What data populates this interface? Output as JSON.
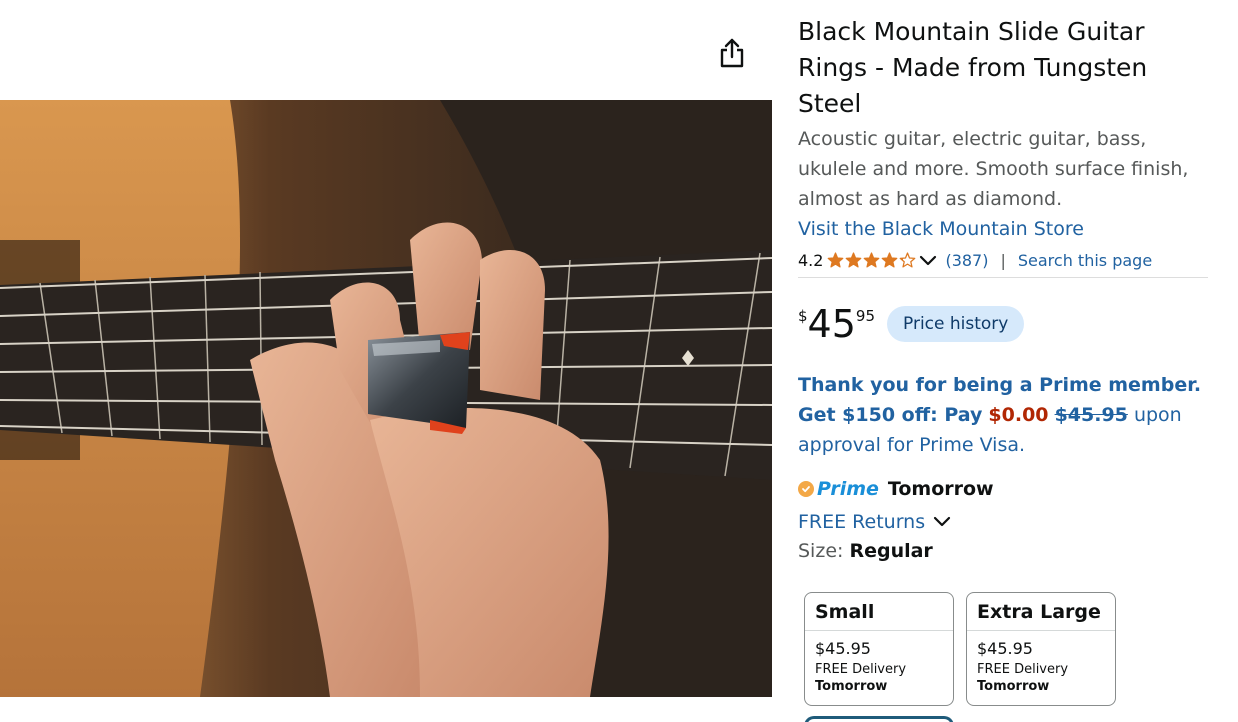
{
  "product": {
    "title": "Black Mountain Slide Guitar Rings - Made from Tungsten Steel",
    "subtitle": "Acoustic guitar, electric guitar, bass, ukulele and more. Smooth surface finish, almost as hard as diamond.",
    "store_link": "Visit the Black Mountain Store"
  },
  "rating": {
    "value": "4.2",
    "stars": 4.2,
    "review_count": "(387)",
    "separator": "|",
    "search_link": "Search this page"
  },
  "price": {
    "symbol": "$",
    "whole": "45",
    "fraction": "95",
    "history_button": "Price history"
  },
  "prime_offer": {
    "line1": "Thank you for being a Prime member.",
    "get_off": "Get $150 off: Pay",
    "pay_amount": "$0.00",
    "old_amount": "$45.95",
    "upon": "upon",
    "approval": "approval for Prime Visa."
  },
  "delivery": {
    "prime_label": "Prime",
    "day": "Tomorrow",
    "returns": "FREE Returns"
  },
  "size": {
    "label": "Size:",
    "selected": "Regular",
    "options": [
      {
        "name": "Small",
        "price": "$45.95",
        "shipping": "FREE Delivery",
        "day": "Tomorrow"
      },
      {
        "name": "Extra Large",
        "price": "$45.95",
        "shipping": "FREE Delivery",
        "day": "Tomorrow"
      }
    ]
  },
  "colors": {
    "link": "#2162a1",
    "price_red": "#b12704",
    "star": "#de7921",
    "prime_blue": "#1a8fd8",
    "price_history_bg": "#d6e9fb"
  },
  "icons": {
    "share": "share-icon",
    "star": "star-icon",
    "chevron": "chevron-down-icon",
    "prime_check": "prime-check-icon"
  }
}
